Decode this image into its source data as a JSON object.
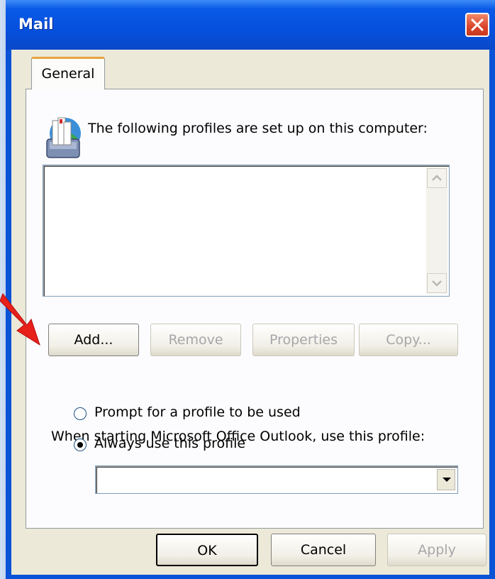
{
  "window": {
    "title": "Mail"
  },
  "tabs": [
    {
      "label": "General",
      "active": true
    }
  ],
  "general": {
    "profiles_label": "The following profiles are set up on this computer:",
    "profiles": [],
    "buttons": {
      "add": "Add...",
      "remove": "Remove",
      "properties": "Properties",
      "copy": "Copy..."
    },
    "startup_label": "When starting Microsoft Office Outlook, use this profile:",
    "radio_prompt": "Prompt for a profile to be used",
    "radio_always": "Always use this profile",
    "selected_radio": "always",
    "profile_select_value": ""
  },
  "footer": {
    "ok": "OK",
    "cancel": "Cancel",
    "apply": "Apply"
  },
  "icons": [
    "close-icon",
    "mail-profiles-icon",
    "scroll-up-icon",
    "scroll-down-icon",
    "dropdown-arrow-icon",
    "red-arrow-annotation"
  ],
  "colors": {
    "titlebar": "#0a52d6",
    "dialog_bg": "#ece9d8",
    "tab_accent": "#e8a33d",
    "close_red": "#d9442b",
    "arrow_red": "#e8201a"
  }
}
